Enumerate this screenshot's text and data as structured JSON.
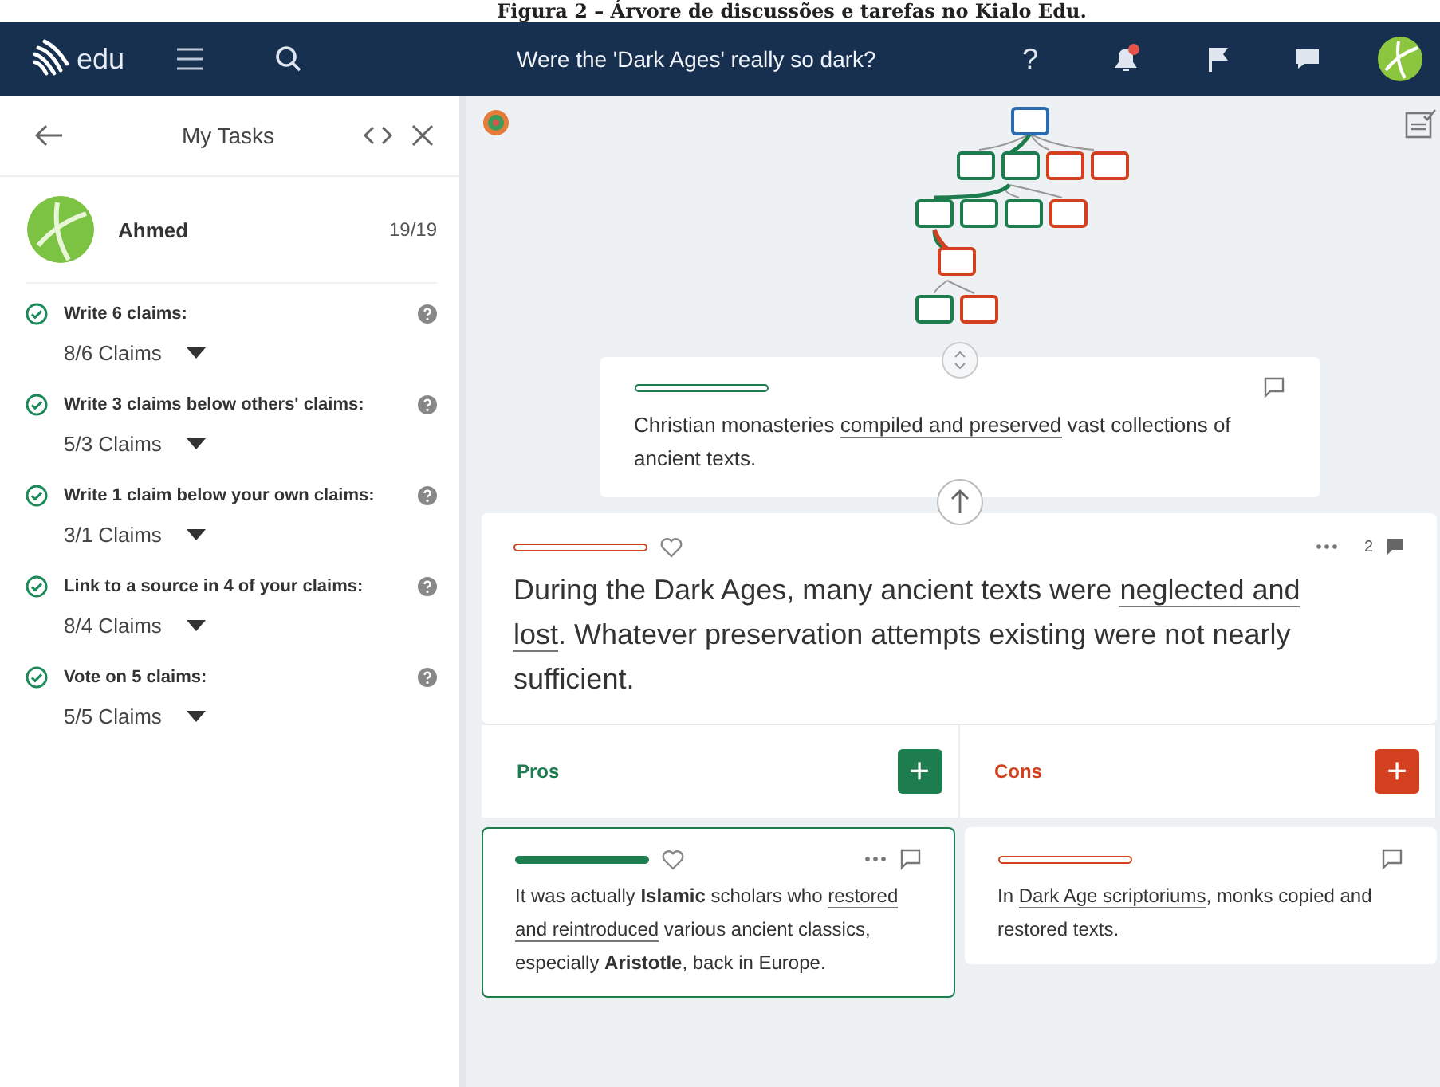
{
  "caption": "Figura 2 – Árvore de discussões e tarefas no Kialo Edu.",
  "navbar": {
    "logo": "edu",
    "title": "Were the 'Dark Ages' really so dark?",
    "help": "?",
    "notification": true
  },
  "tasks_panel": {
    "title": "My Tasks",
    "user": "Ahmed",
    "score": "19/19",
    "tasks": [
      {
        "title": "**Write** 6 claims:",
        "count": "8/6 Claims",
        "done": true
      },
      {
        "title": "**Write** 3 claims below others' claims:",
        "count": "5/3 Claims",
        "done": true
      },
      {
        "title": "**Write** 1 claim below your own claims:",
        "count": "3/1 Claims",
        "done": true
      },
      {
        "title": "**Link to a source** in 4 of your claims:",
        "count": "8/4 Claims",
        "done": true
      },
      {
        "title": "**Vote** on 5 claims:",
        "count": "5/5 Claims",
        "done": true
      }
    ]
  },
  "parent_claim": {
    "color": "#1e7d4f",
    "segments": [
      {
        "text": "Christian monasteries ",
        "underlined": false
      },
      {
        "text": "compiled and preserved",
        "underlined": true
      },
      {
        "text": " vast collections of ancient texts.",
        "underlined": false
      }
    ]
  },
  "main_claim": {
    "color": "#d2401f",
    "comments": "2",
    "segments": [
      {
        "text": "During the Dark Ages, many ancient texts were ",
        "underlined": false
      },
      {
        "text": "neglected and lost",
        "underlined": true
      },
      {
        "text": ". Whatever preservation attempts existing were not nearly sufficient.",
        "underlined": false
      }
    ]
  },
  "columns": [
    {
      "label": "Pros",
      "kind": "pro",
      "add": "+"
    },
    {
      "label": "Cons",
      "kind": "con",
      "add": "+"
    }
  ],
  "cards": [
    {
      "color": "#1e7d4f",
      "selected": true,
      "segments": [
        {
          "text": "It was actually **Islamic** scholars who ",
          "underlined": false
        },
        {
          "text": "restored and reintroduced",
          "underlined": true
        },
        {
          "text": " various ancient classics, especially **Aristotle**, back in Europe.",
          "underlined": false
        }
      ]
    },
    {
      "color": "#d2401f",
      "selected": false,
      "segments": [
        {
          "text": "In ",
          "underlined": false
        },
        {
          "text": "Dark Age scriptoriums",
          "underlined": true
        },
        {
          "text": ", monks copied and restored texts.",
          "underlined": false
        }
      ]
    }
  ]
}
